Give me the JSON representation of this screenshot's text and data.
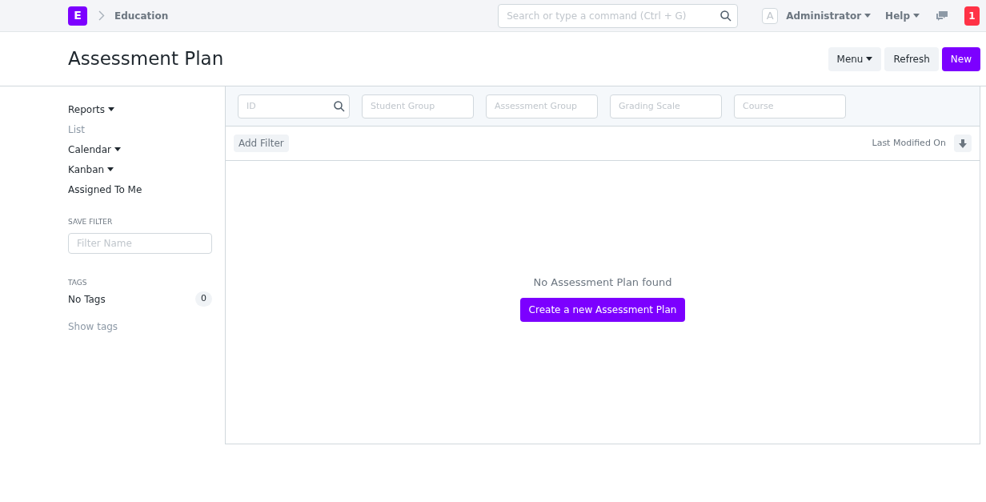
{
  "navbar": {
    "logo_letter": "E",
    "breadcrumb": "Education",
    "search": {
      "placeholder": "Search or type a command (Ctrl + G)"
    },
    "avatar_letter": "A",
    "user": "Administrator",
    "help": "Help",
    "notifications": "1"
  },
  "page": {
    "title": "Assessment Plan",
    "buttons": [
      {
        "label": "Menu",
        "kind": "dropdown"
      },
      {
        "label": "Refresh",
        "kind": "default"
      },
      {
        "label": "New",
        "kind": "primary"
      }
    ]
  },
  "sidebar": {
    "items": [
      {
        "label": "Reports",
        "kind": "dropdown",
        "selected": false
      },
      {
        "label": "List",
        "kind": "link",
        "selected": true
      },
      {
        "label": "Calendar",
        "kind": "dropdown",
        "selected": false
      },
      {
        "label": "Kanban",
        "kind": "dropdown",
        "selected": false
      },
      {
        "label": "Assigned To Me",
        "kind": "link",
        "selected": false
      }
    ],
    "save_filter": {
      "heading": "SAVE FILTER",
      "placeholder": "Filter Name"
    },
    "tags": {
      "heading": "TAGS",
      "label": "No Tags",
      "count": "0",
      "show": "Show tags"
    }
  },
  "filters": [
    {
      "placeholder": "ID",
      "kind": "search"
    },
    {
      "placeholder": "Student Group",
      "kind": "plain"
    },
    {
      "placeholder": "Assessment Group",
      "kind": "plain"
    },
    {
      "placeholder": "Grading Scale",
      "kind": "plain"
    },
    {
      "placeholder": "Course",
      "kind": "plain"
    }
  ],
  "toolbar": {
    "add_filter": "Add Filter",
    "sort_label": "Last Modified On"
  },
  "empty": {
    "message": "No Assessment Plan found",
    "action": "Create a new Assessment Plan"
  }
}
